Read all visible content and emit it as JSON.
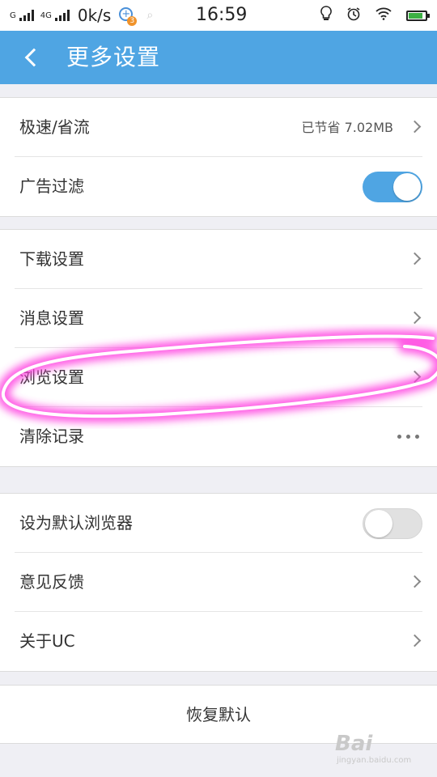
{
  "status_bar": {
    "carrier1": "G",
    "carrier2": "4G",
    "speed": "0k/s",
    "notification_badge": "3",
    "time": "16:59",
    "battery_level": 0.85
  },
  "header": {
    "title": "更多设置"
  },
  "sections": [
    {
      "rows": [
        {
          "label": "极速/省流",
          "value": "已节省 7.02MB",
          "control": "chevron"
        },
        {
          "label": "广告过滤",
          "control": "toggle",
          "state": "on"
        }
      ]
    },
    {
      "rows": [
        {
          "label": "下载设置",
          "control": "chevron"
        },
        {
          "label": "消息设置",
          "control": "chevron"
        },
        {
          "label": "浏览设置",
          "control": "chevron"
        },
        {
          "label": "清除记录",
          "control": "more"
        }
      ]
    },
    {
      "rows": [
        {
          "label": "设为默认浏览器",
          "control": "toggle",
          "state": "off"
        },
        {
          "label": "意见反馈",
          "control": "chevron"
        },
        {
          "label": "关于UC",
          "control": "chevron"
        }
      ]
    }
  ],
  "restore_label": "恢复默认",
  "colors": {
    "accent": "#4fa5e3",
    "highlight": "#ff40e0"
  },
  "watermark": {
    "brand": "Bai",
    "url": "jingyan.baidu.com"
  }
}
